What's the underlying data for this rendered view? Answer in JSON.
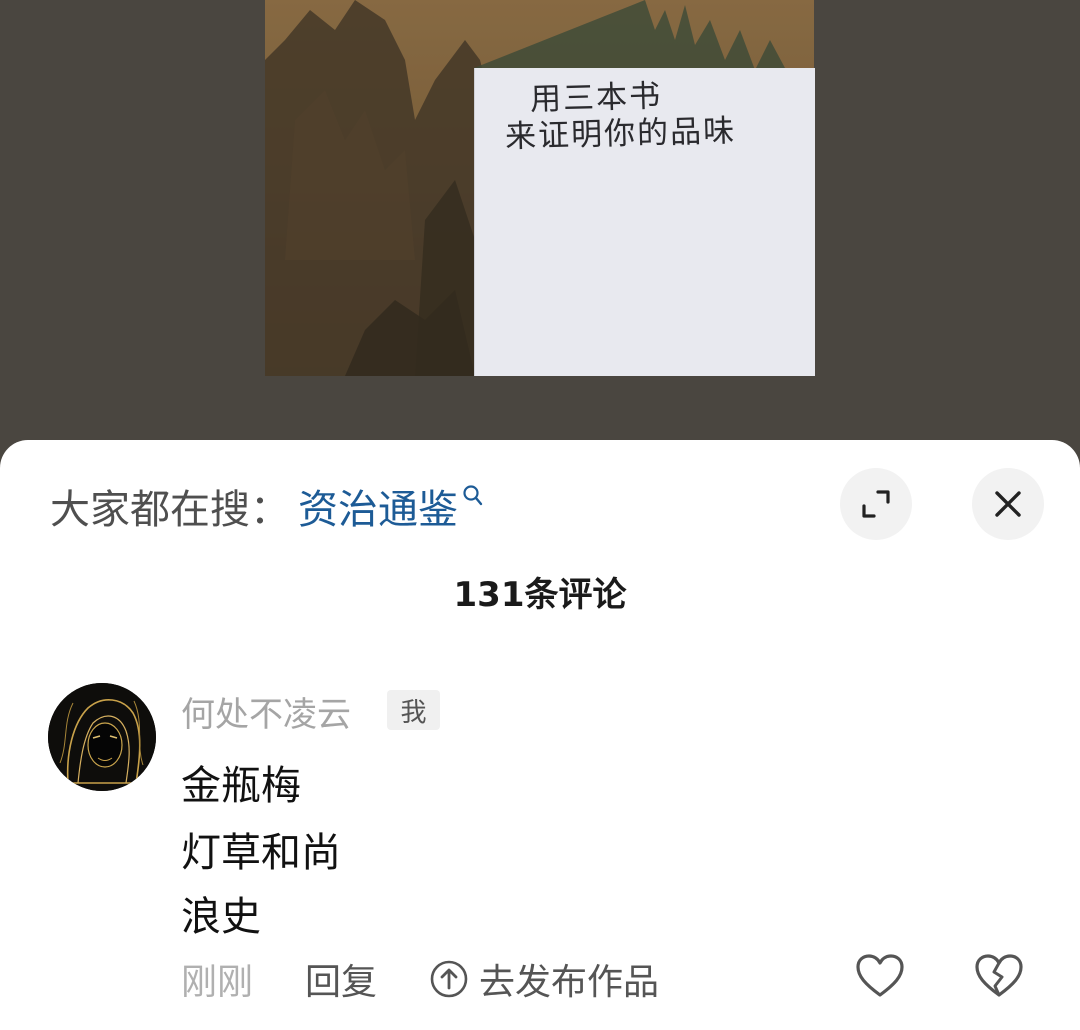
{
  "note": {
    "line1": "用三本书",
    "line2": "来证明你的品味"
  },
  "search": {
    "prefix": "大家都在搜：",
    "term": "资治通鉴",
    "icon": "search-icon"
  },
  "controls": {
    "expand_icon": "expand-icon",
    "close_icon": "close-icon"
  },
  "comments_header": {
    "count_label": "131条评论"
  },
  "comment": {
    "username": "何处不凌云",
    "badge": "我",
    "lines": [
      "金瓶梅",
      "灯草和尚",
      "浪史"
    ],
    "time": "刚刚",
    "reply_label": "回复",
    "publish_label": "去发布作品"
  },
  "colors": {
    "link": "#1d5b96",
    "background": "#494540",
    "sheet": "#ffffff"
  }
}
